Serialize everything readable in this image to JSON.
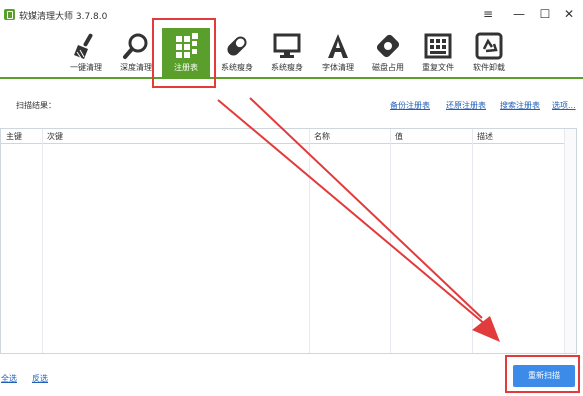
{
  "app": {
    "title": "软媒清理大师 3.7.8.0",
    "window_controls": {
      "menu": "≡",
      "minimize": "—",
      "maximize": "☐",
      "close": "✕"
    }
  },
  "toolbar": {
    "items": [
      {
        "label": "一键清理",
        "icon": "broom-icon"
      },
      {
        "label": "深度清理",
        "icon": "magnifier-icon"
      },
      {
        "label": "注册表",
        "icon": "registry-blocks-icon",
        "active": true
      },
      {
        "label": "系统瘦身",
        "icon": "pill-icon"
      },
      {
        "label": "系统瘦身",
        "icon": "monitor-icon"
      },
      {
        "label": "字体清理",
        "icon": "font-a-icon"
      },
      {
        "label": "磁盘占用",
        "icon": "disk-tag-icon"
      },
      {
        "label": "重复文件",
        "icon": "duplicate-files-icon"
      },
      {
        "label": "软件卸载",
        "icon": "recycle-icon"
      }
    ],
    "accent_color": "#5a9e2c"
  },
  "scan": {
    "label": "扫描结果：",
    "links": [
      "备份注册表",
      "还原注册表",
      "搜索注册表",
      "选项..."
    ]
  },
  "table": {
    "columns": [
      "主键",
      "次键",
      "名称",
      "值",
      "描述"
    ],
    "rows": []
  },
  "footer": {
    "select_all": "全选",
    "invert": "反选",
    "rescan_button": "重新扫描"
  },
  "annotation_color": "#e23b3b"
}
